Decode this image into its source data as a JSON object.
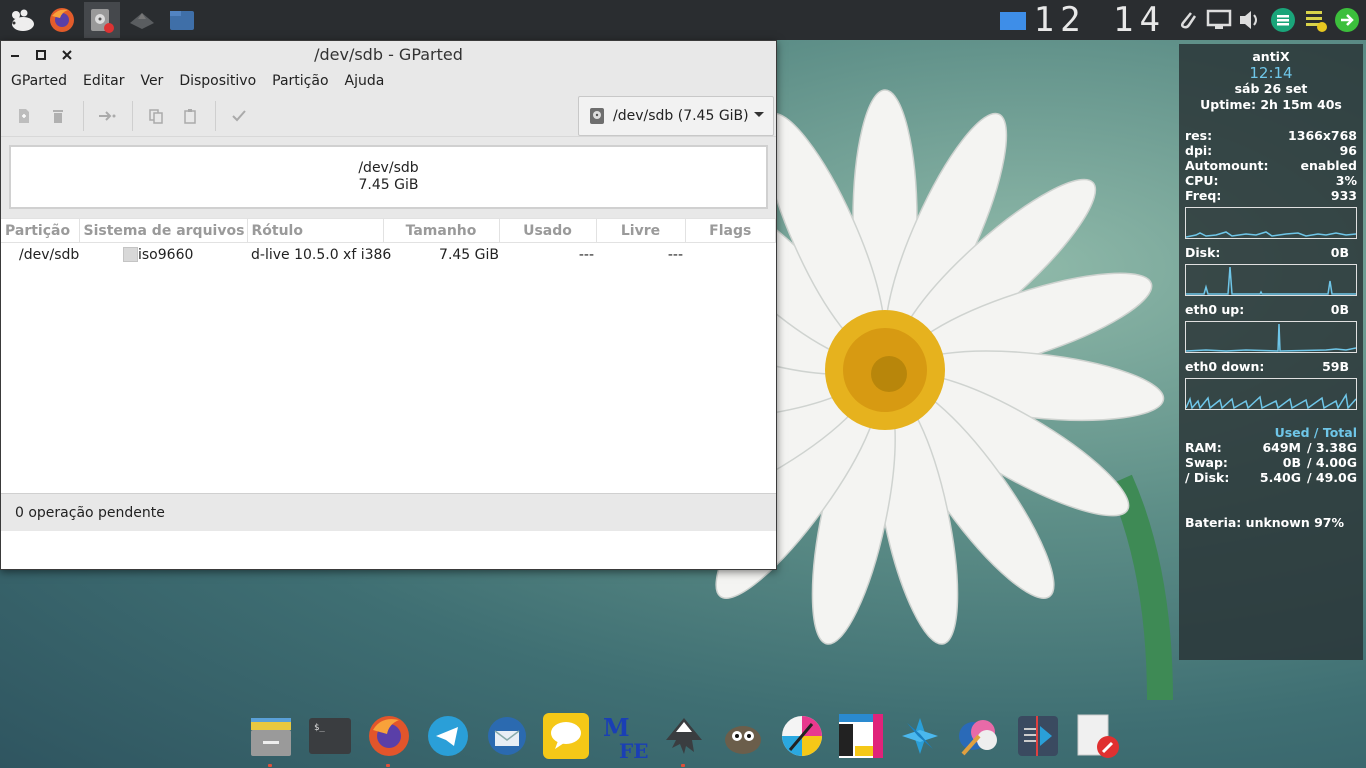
{
  "topbar": {
    "launchers": [
      "menu-mouse-icon",
      "firefox-icon",
      "gparted-icon",
      "unknown-app-icon",
      "file-manager-icon"
    ],
    "clock_digits": "12 14",
    "tray": [
      "workspace-icon",
      "paperclip-icon",
      "display-icon",
      "volume-icon",
      "network-icon",
      "clipboard-icon",
      "update-icon"
    ]
  },
  "window": {
    "title": "/dev/sdb - GParted",
    "menu": [
      "GParted",
      "Editar",
      "Ver",
      "Dispositivo",
      "Partição",
      "Ajuda"
    ],
    "device_selector": "/dev/sdb (7.45 GiB)",
    "diskmap": {
      "device": "/dev/sdb",
      "size": "7.45 GiB"
    },
    "table": {
      "headers": [
        "Partição",
        "Sistema de arquivos",
        "Rótulo",
        "Tamanho",
        "Usado",
        "Livre",
        "Flags"
      ],
      "rows": [
        {
          "partition": "/dev/sdb",
          "filesystem": "iso9660",
          "label": "d-live 10.5.0 xf i386",
          "size": "7.45 GiB",
          "used": "---",
          "free": "---",
          "flags": ""
        }
      ]
    },
    "status": "0 operação pendente"
  },
  "conky": {
    "host": "antiX",
    "time": "12:14",
    "date": "sáb 26 set",
    "uptime": "Uptime: 2h 15m 40s",
    "stats": [
      {
        "k": "res:",
        "v": "1366x768"
      },
      {
        "k": "dpi:",
        "v": "96"
      },
      {
        "k": "Automount:",
        "v": "enabled"
      },
      {
        "k": "CPU:",
        "v": "3%"
      },
      {
        "k": "Freq:",
        "v": "933"
      }
    ],
    "disk": {
      "k": "Disk:",
      "v": "0B"
    },
    "eth_up": {
      "k": "eth0 up:",
      "v": "0B"
    },
    "eth_down": {
      "k": "eth0 down:",
      "v": "59B"
    },
    "used_total_label": "Used / Total",
    "mem": [
      {
        "k": "RAM:",
        "a": "649M",
        "b": "/ 3.38G"
      },
      {
        "k": "Swap:",
        "a": "0B",
        "b": "/ 4.00G"
      },
      {
        "k": "/ Disk:",
        "a": "5.40G",
        "b": "/ 49.0G"
      }
    ],
    "battery_label": "Bateria:",
    "battery_value": "unknown 97%"
  },
  "dock": [
    "file-manager-icon",
    "terminal-icon",
    "firefox-icon",
    "telegram-icon",
    "thunderbird-icon",
    "messages-icon",
    "mfe-icon",
    "inkscape-icon",
    "gimp-icon",
    "paint-icon",
    "layout-icon",
    "blue-flower-icon",
    "palette-icon",
    "media-icon",
    "notes-icon"
  ],
  "colors": {
    "accent": "#6fc6e8",
    "panel": "#2a2d30"
  }
}
